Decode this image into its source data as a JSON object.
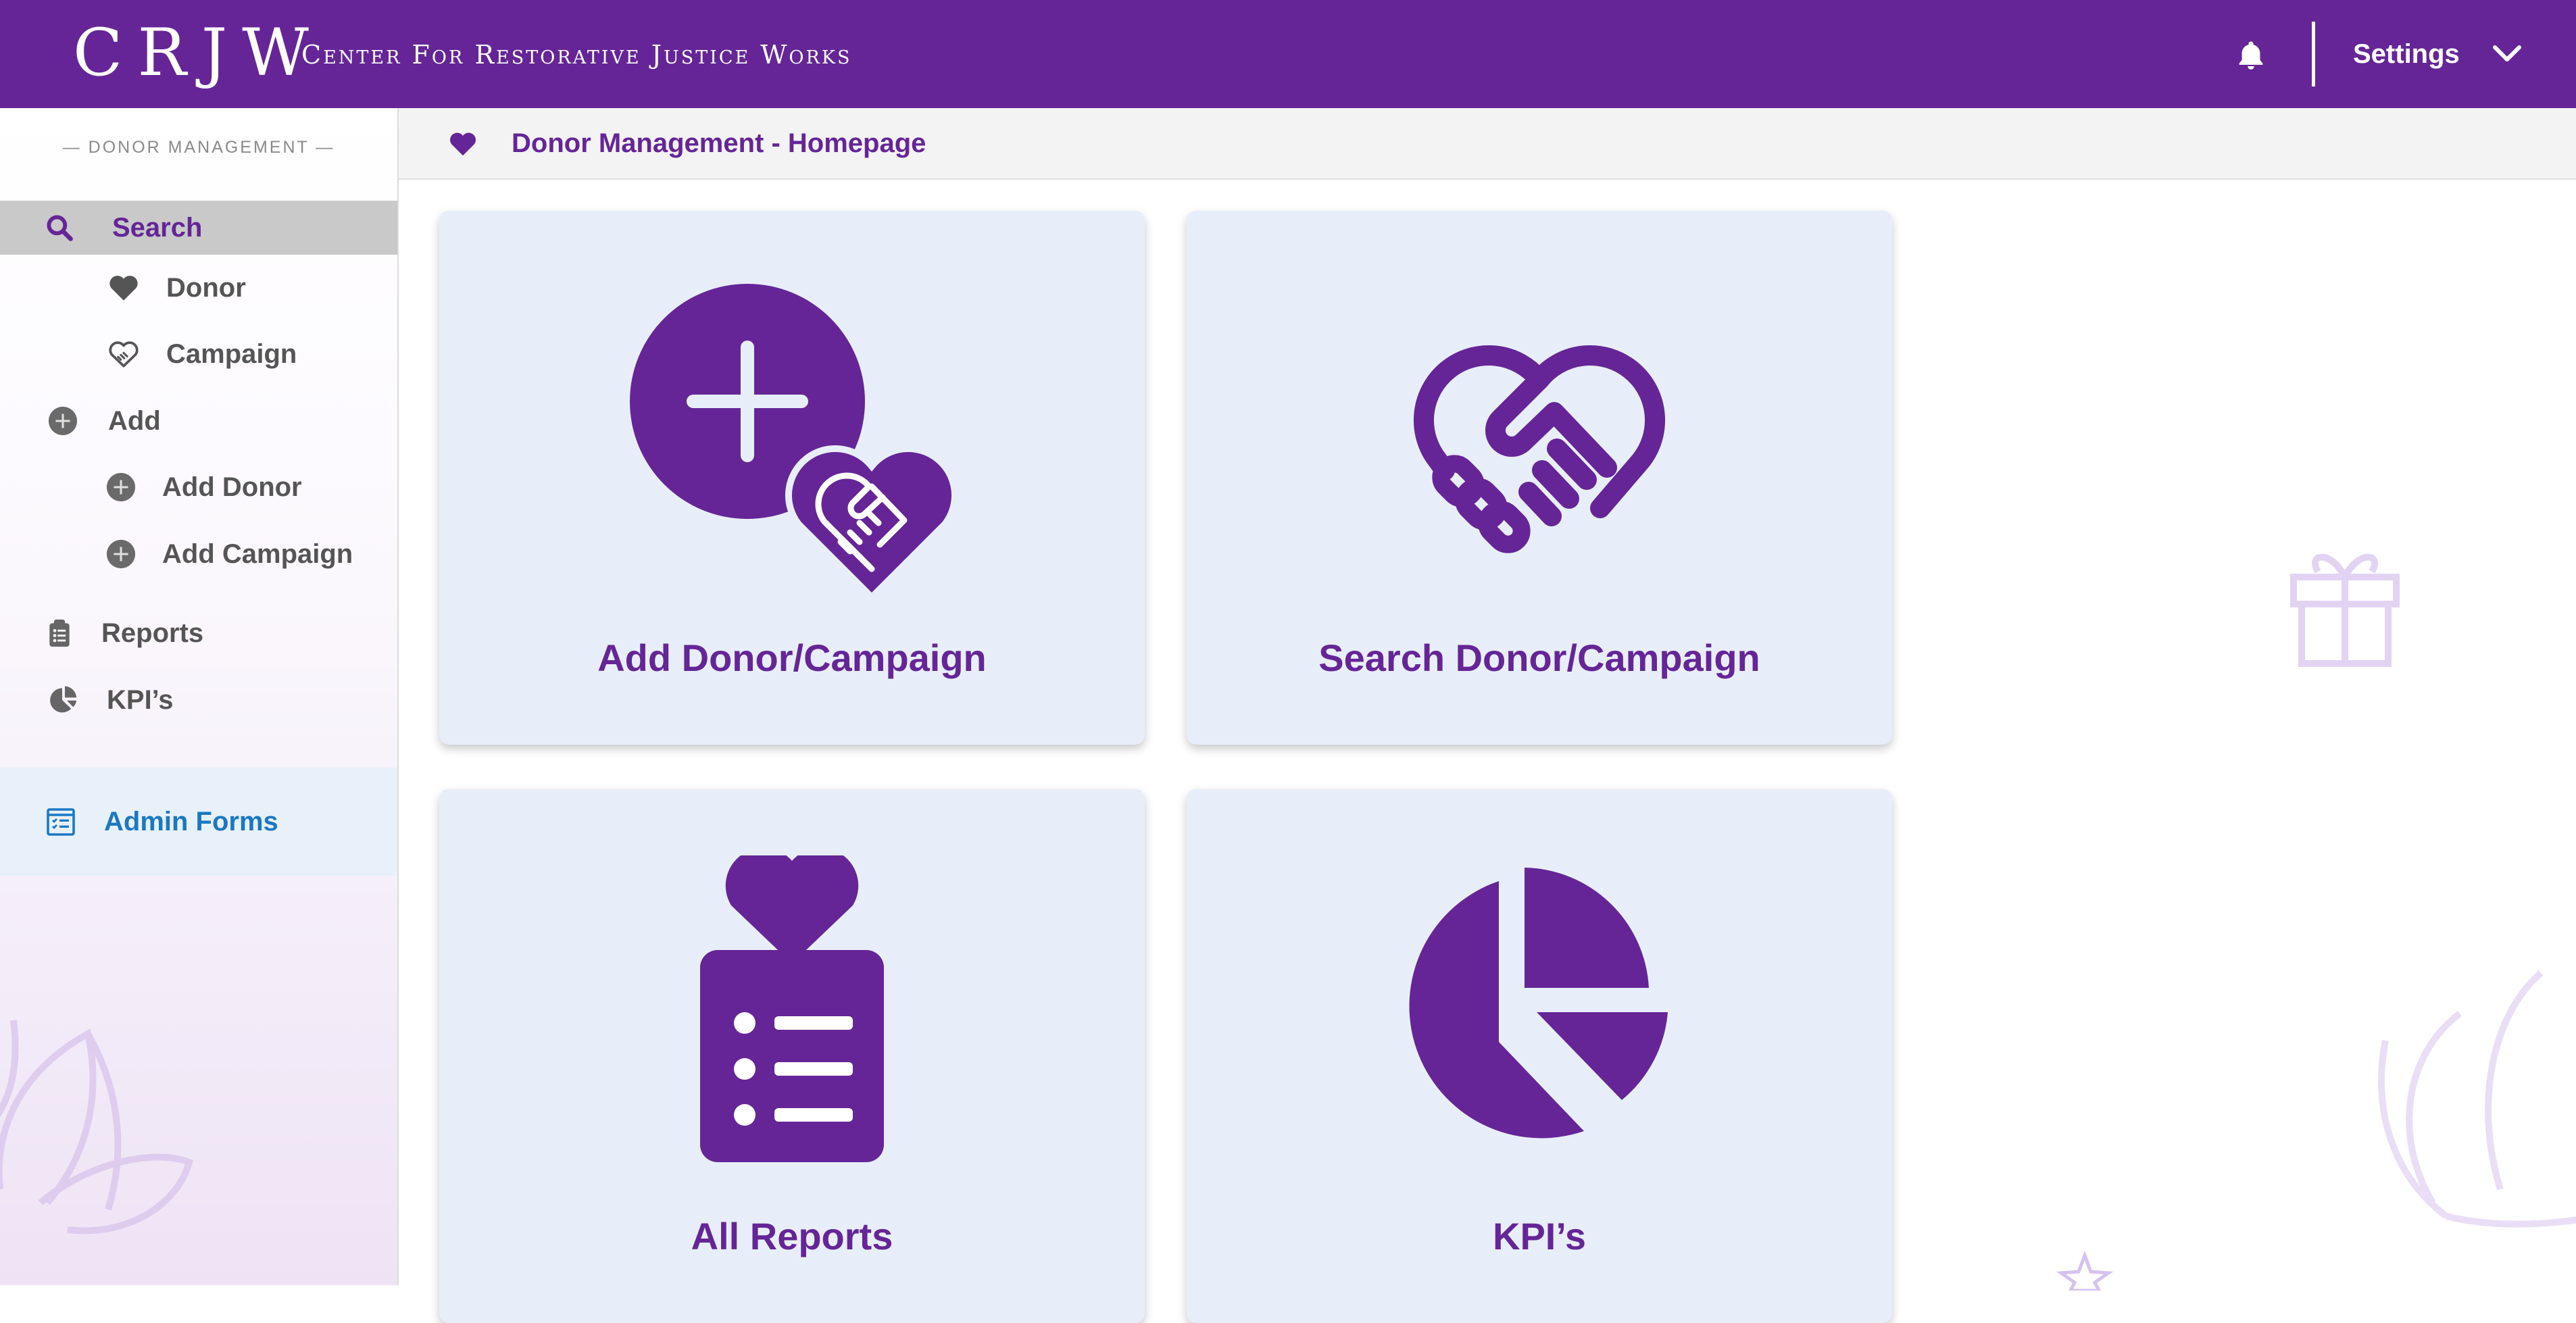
{
  "header": {
    "logo_mark": "CRJW",
    "logo_text": "Center For Restorative Justice Works",
    "settings_label": "Settings"
  },
  "colors": {
    "brand_purple": "#652597",
    "tile_bg": "#e7eef9",
    "admin_blue": "#1b78c2",
    "active_bg": "#c9c9c9"
  },
  "sidebar": {
    "section_title": "— DONOR MANAGEMENT —",
    "items": [
      {
        "label": "Search",
        "icon": "search-icon",
        "active": true
      },
      {
        "label": "Donor",
        "icon": "heart-icon"
      },
      {
        "label": "Campaign",
        "icon": "handshake-heart-icon"
      },
      {
        "label": "Add",
        "icon": "plus-circle-icon"
      },
      {
        "label": "Add Donor",
        "icon": "plus-circle-icon"
      },
      {
        "label": "Add Campaign",
        "icon": "plus-circle-icon"
      },
      {
        "label": "Reports",
        "icon": "clipboard-list-icon"
      },
      {
        "label": "KPI’s",
        "icon": "pie-chart-icon"
      }
    ],
    "admin": {
      "label": "Admin Forms",
      "icon": "form-list-icon"
    }
  },
  "breadcrumb": {
    "label": "Donor Management - Homepage",
    "icon": "heart-icon"
  },
  "tiles": [
    {
      "label": "Add Donor/Campaign",
      "icon": "add-heart-icon"
    },
    {
      "label": "Search Donor/Campaign",
      "icon": "handshake-heart-icon"
    },
    {
      "label": "All Reports",
      "icon": "clipboard-heart-icon"
    },
    {
      "label": "KPI’s",
      "icon": "pie-chart-icon"
    }
  ]
}
